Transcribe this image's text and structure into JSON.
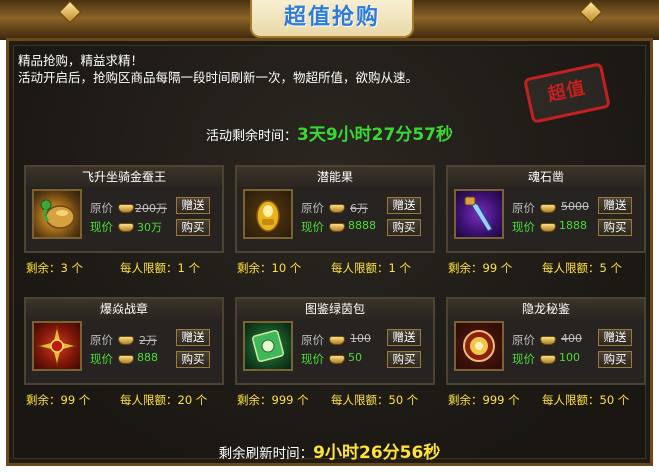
{
  "window": {
    "title": "超值抢购"
  },
  "intro": {
    "line1": "精品抢购，精益求精！",
    "line2": "活动开启后，抢购区商品每隔一段时间刷新一次，物超所值，欲购从速。"
  },
  "stamp": "超值",
  "activity_timer": {
    "label": "活动剩余时间：",
    "value": "3天9小时27分57秒"
  },
  "refresh_timer": {
    "label": "剩余刷新时间：",
    "value": "9小时26分56秒"
  },
  "labels": {
    "original": "原价",
    "current": "现价",
    "gift": "赠送",
    "buy": "购买",
    "remaining": "剩余：",
    "limit": "每人限额：",
    "unit": "个"
  },
  "items": [
    {
      "name": "飞升坐骑金蚕王",
      "orig": "200万",
      "now": "30万",
      "remain": "3",
      "limit": "1",
      "icon": "golden-silkworm-icon"
    },
    {
      "name": "潜能果",
      "orig": "6万",
      "now": "8888",
      "remain": "10",
      "limit": "1",
      "icon": "potential-fruit-icon"
    },
    {
      "name": "魂石凿",
      "orig": "5000",
      "now": "1888",
      "remain": "99",
      "limit": "5",
      "icon": "soul-chisel-icon"
    },
    {
      "name": "爆焱战章",
      "orig": "2万",
      "now": "888",
      "remain": "99",
      "limit": "20",
      "icon": "flame-war-badge-icon"
    },
    {
      "name": "图鉴绿茵包",
      "orig": "100",
      "now": "50",
      "remain": "999",
      "limit": "50",
      "icon": "green-pack-icon"
    },
    {
      "name": "隐龙秘鉴",
      "orig": "400",
      "now": "100",
      "remain": "999",
      "limit": "50",
      "icon": "dragon-mirror-icon"
    }
  ],
  "colors": {
    "title_blue": "#2c7cd8",
    "timer_green": "#39d934",
    "price_green": "#4ddc3c",
    "stock_yellow": "#ffe23a",
    "stamp_red": "#c52020"
  }
}
